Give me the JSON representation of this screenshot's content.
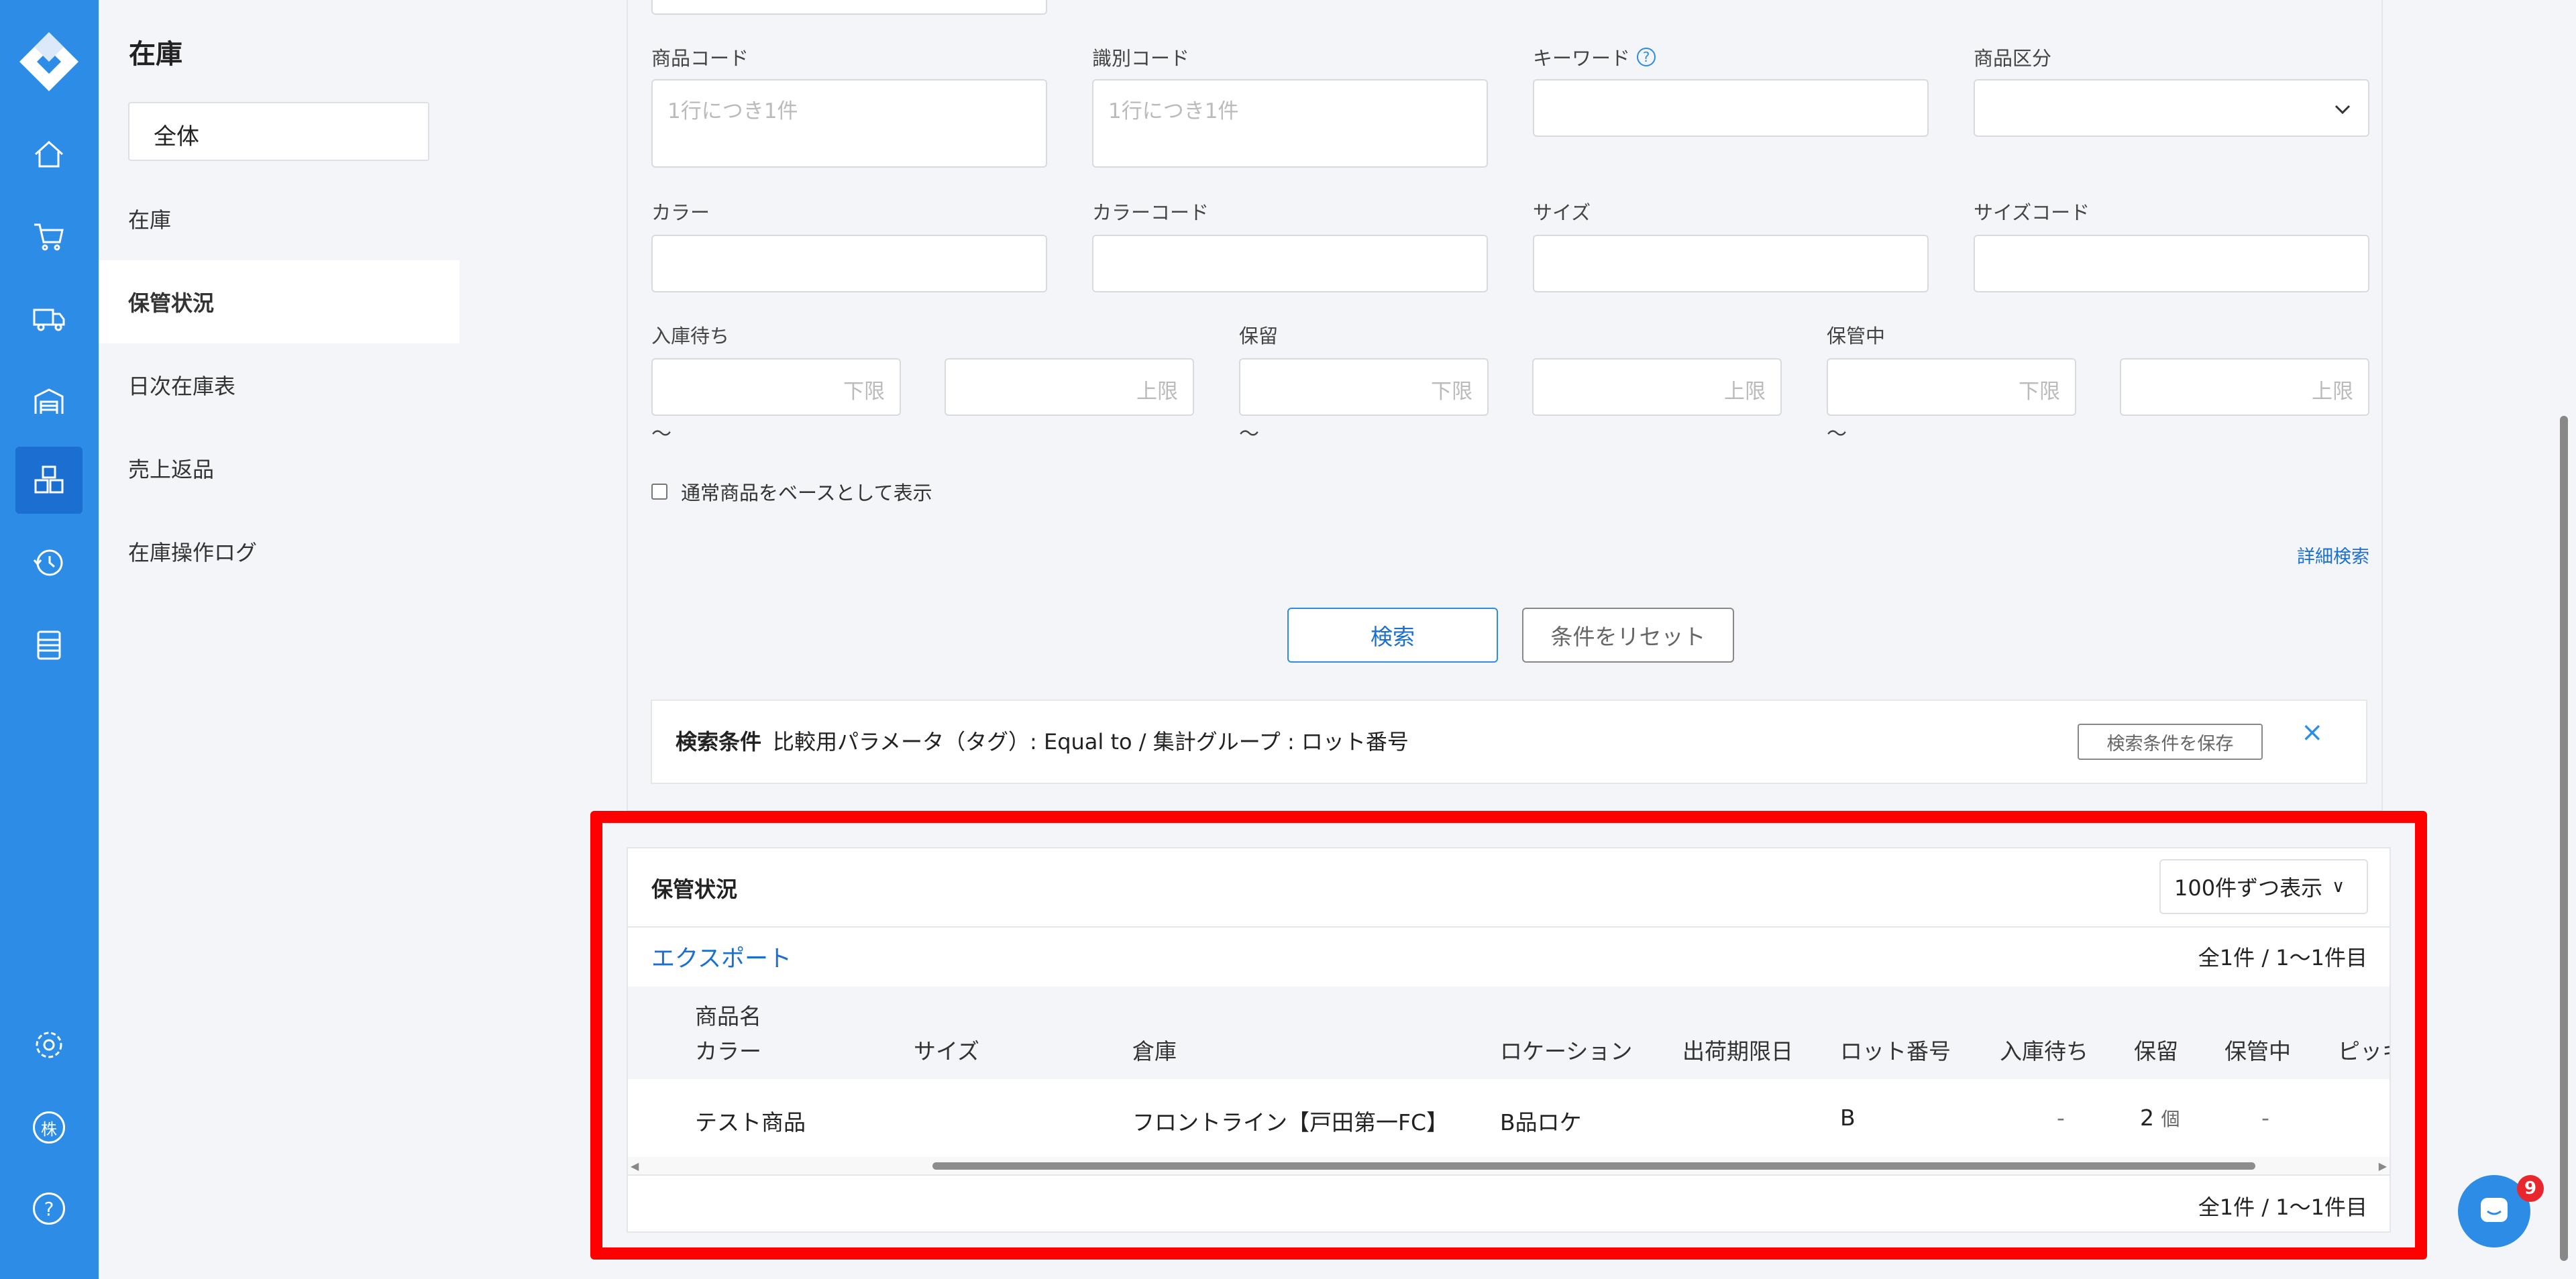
{
  "sidebar": {
    "title": "在庫",
    "scope_select": "全体",
    "items": [
      {
        "label": "在庫"
      },
      {
        "label": "保管状況"
      },
      {
        "label": "日次在庫表"
      },
      {
        "label": "売上返品"
      },
      {
        "label": "在庫操作ログ"
      }
    ]
  },
  "rail": {
    "icons": [
      "home-icon",
      "cart-icon",
      "truck-icon",
      "warehouse-icon",
      "boxes-icon",
      "history-icon",
      "list-icon",
      "settings-icon",
      "company-icon",
      "help-icon"
    ],
    "company_label": "株",
    "help_label": "?"
  },
  "search": {
    "product_code_label": "商品コード",
    "product_code_placeholder": "1行につき1件",
    "identifier_code_label": "識別コード",
    "identifier_code_placeholder": "1行につき1件",
    "keyword_label": "キーワード",
    "category_label": "商品区分",
    "color_label": "カラー",
    "color_code_label": "カラーコード",
    "size_label": "サイズ",
    "size_code_label": "サイズコード",
    "awaiting_label": "入庫待ち",
    "hold_label": "保留",
    "storing_label": "保管中",
    "lower_placeholder": "下限",
    "upper_placeholder": "上限",
    "tilde": "〜",
    "checkbox_label": "通常商品をベースとして表示",
    "detail_link": "詳細検索",
    "search_button": "検索",
    "reset_button": "条件をリセット"
  },
  "conditions": {
    "title": "検索条件",
    "text": "比較用パラメータ（タグ）: Equal to / 集計グループ : ロット番号",
    "save_button": "検索条件を保存",
    "close": "×"
  },
  "results": {
    "title": "保管状況",
    "per_page": "100件ずつ表示",
    "export": "エクスポート",
    "count": "全1件 / 1〜1件目",
    "headers": {
      "name": "商品名",
      "color": "カラー",
      "size": "サイズ",
      "warehouse": "倉庫",
      "location": "ロケーション",
      "ship_deadline": "出荷期限日",
      "lot": "ロット番号",
      "awaiting": "入庫待ち",
      "hold": "保留",
      "storing": "保管中",
      "picking": "ピッキ"
    },
    "rows": [
      {
        "name": "テスト商品",
        "warehouse": "フロントライン【戸田第一FC】",
        "location": "B品ロケ",
        "lot": "B",
        "awaiting": "-",
        "hold": "2",
        "hold_unit": "個",
        "storing": "-"
      }
    ]
  },
  "chat": {
    "badge": "9"
  },
  "colors": {
    "accent": "#2c8ce6",
    "highlight": "#ff0000",
    "badge": "#e8262c"
  }
}
